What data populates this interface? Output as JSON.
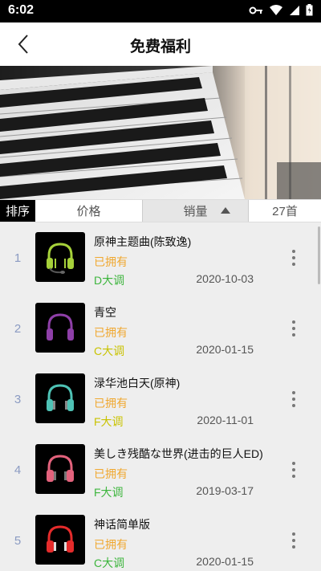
{
  "status": {
    "time": "6:02"
  },
  "header": {
    "title": "免费福利"
  },
  "sortbar": {
    "label": "排序",
    "price": "价格",
    "sales": "销量",
    "count": "27首"
  },
  "colors": {
    "owned": "#f0a830",
    "key_green": "#3db53d",
    "key_yellow": "#c9c300",
    "index": "#8b9bc2"
  },
  "songs": [
    {
      "index": "1",
      "name": "原神主题曲(陈致逸)",
      "status": "已拥有",
      "key": "D大调",
      "key_color": "#3db53d",
      "date": "2020-10-03",
      "icon": "headphones-lime-mic-icon",
      "color": "#a6d13a"
    },
    {
      "index": "2",
      "name": "青空",
      "status": "已拥有",
      "key": "C大调",
      "key_color": "#c9c300",
      "date": "2020-01-15",
      "icon": "headphones-purple-icon",
      "color": "#8e3fa8"
    },
    {
      "index": "3",
      "name": "渌华池白天(原神)",
      "status": "已拥有",
      "key": "F大调",
      "key_color": "#c9c300",
      "date": "2020-11-01",
      "icon": "headphones-teal-icon",
      "color": "#4ec2b5"
    },
    {
      "index": "4",
      "name": "美しき残酷な世界(进击的巨人ED)",
      "status": "已拥有",
      "key": "F大调",
      "key_color": "#3db53d",
      "date": "2019-03-17",
      "icon": "headphones-pink-icon",
      "color": "#e3627c"
    },
    {
      "index": "5",
      "name": "神话简单版",
      "status": "已拥有",
      "key": "C大调",
      "key_color": "#3db53d",
      "date": "2020-01-15",
      "icon": "headphones-red-icon",
      "color": "#e52b2b"
    }
  ]
}
